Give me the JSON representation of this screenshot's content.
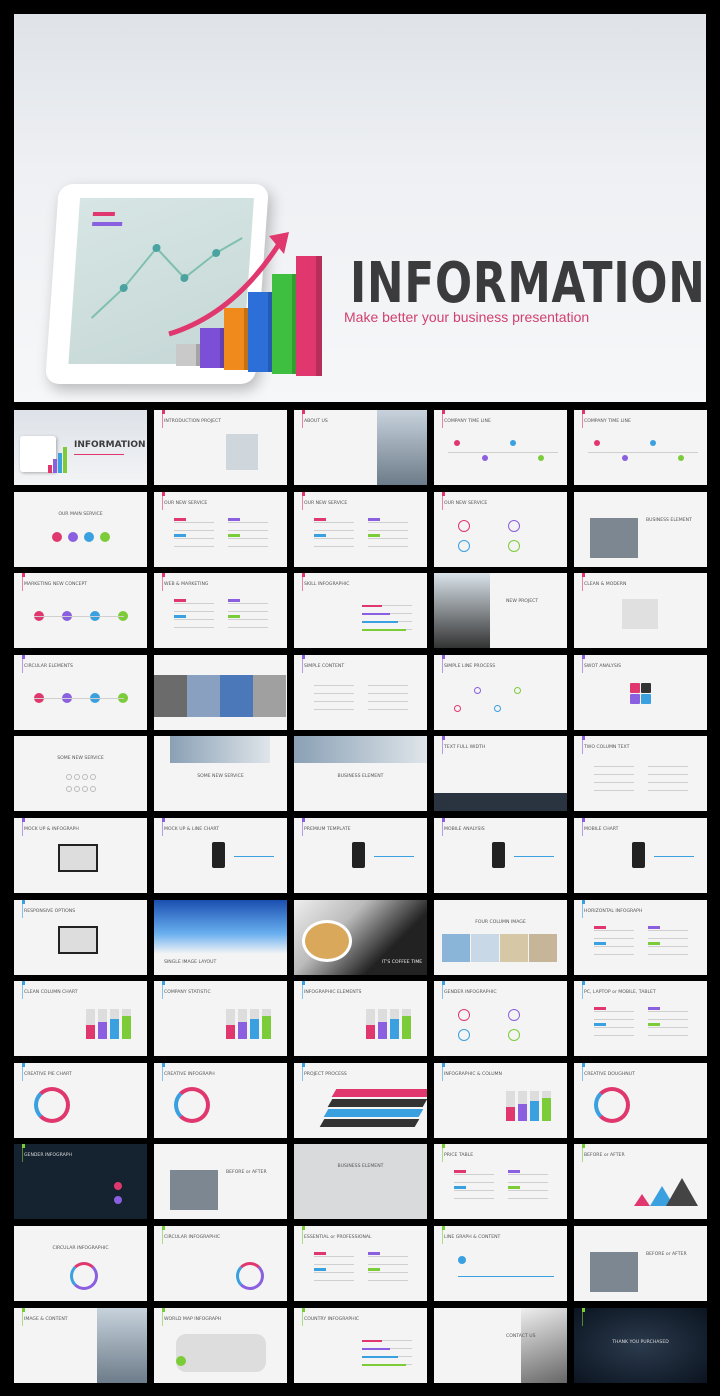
{
  "hero": {
    "title": "INFORMATION",
    "subtitle": "Make better your business presentation",
    "accent": "#d2406e",
    "bar_colors": [
      "#c9c9c9",
      "#7b4fd6",
      "#f08a1c",
      "#2d6fd8",
      "#3fbf3f",
      "#e0386e"
    ]
  },
  "colors": {
    "pink": "#e0386e",
    "purple": "#8a5fe0",
    "blue": "#3aa0e0",
    "green": "#7ccc3a",
    "dark": "#333333"
  },
  "slides": [
    {
      "title": "INFORMATION",
      "type": "cover"
    },
    {
      "title": "INTRODUCTION PROJECT",
      "type": "text",
      "decor": "photo-right-small"
    },
    {
      "title": "ABOUT US",
      "type": "text",
      "decor": "photo-right"
    },
    {
      "title": "COMPANY TIME LINE",
      "type": "text",
      "decor": "timeline"
    },
    {
      "title": "COMPANY TIME LINE",
      "type": "text",
      "decor": "timeline"
    },
    {
      "title": "OUR MAIN SERVICE",
      "type": "center",
      "decor": "circles4"
    },
    {
      "title": "OUR NEW SERVICE",
      "type": "text",
      "decor": "tags"
    },
    {
      "title": "OUR NEW SERVICE",
      "type": "text",
      "decor": "list2"
    },
    {
      "title": "OUR NEW SERVICE",
      "type": "text",
      "decor": "rings"
    },
    {
      "title": "BUSINESS ELEMENT",
      "type": "text-right",
      "decor": "photo-left-small"
    },
    {
      "title": "MARKETING NEW CONCEPT",
      "type": "text",
      "decor": "dotline"
    },
    {
      "title": "WEB & MARKETING",
      "type": "text",
      "decor": "list2"
    },
    {
      "title": "SKILL INFOGRAPHIC",
      "type": "text",
      "decor": "bars-h"
    },
    {
      "title": "NEW PROJECT",
      "type": "text-right",
      "decor": "photo-left"
    },
    {
      "title": "CLEAN & MODERN",
      "type": "text",
      "decor": "photo-center"
    },
    {
      "title": "CIRCULAR ELEMENTS",
      "type": "text",
      "decor": "dotline"
    },
    {
      "title": "",
      "type": "photo",
      "decor": "collage"
    },
    {
      "title": "SIMPLE CONTENT",
      "type": "text",
      "decor": "lines"
    },
    {
      "title": "SIMPLE LINE PROCESS",
      "type": "text",
      "decor": "process"
    },
    {
      "title": "SWOT ANALYSIS",
      "type": "text",
      "decor": "swot"
    },
    {
      "title": "SOME NEW SERVICE",
      "type": "center",
      "decor": "icons"
    },
    {
      "title": "SOME NEW SERVICE",
      "type": "center-low",
      "decor": "photo-top"
    },
    {
      "title": "BUSINESS ELEMENT",
      "type": "center-low",
      "decor": "photo-top"
    },
    {
      "title": "TEXT FULL WIDTH",
      "type": "text",
      "decor": "photo-bottom"
    },
    {
      "title": "TWO COLUMN TEXT",
      "type": "text",
      "decor": "lines"
    },
    {
      "title": "MOCK UP & INFOGRAPH",
      "type": "text",
      "decor": "monitor"
    },
    {
      "title": "MOCK UP & LINE CHART",
      "type": "text",
      "decor": "phone"
    },
    {
      "title": "PREMIUM TEMPLATE",
      "type": "text",
      "decor": "phone"
    },
    {
      "title": "MOBILE ANALYSIS",
      "type": "text",
      "decor": "phone"
    },
    {
      "title": "MOBILE CHART",
      "type": "text",
      "decor": "phone"
    },
    {
      "title": "RESPONSIVE OPTIONS",
      "type": "text",
      "decor": "monitor"
    },
    {
      "title": "SINGLE IMAGE LAYOUT",
      "type": "photo-bottom-title",
      "decor": "sky"
    },
    {
      "title": "IT'S COFFEE TIME",
      "type": "photo-bottom-title",
      "decor": "coffee"
    },
    {
      "title": "FOUR COLUMN IMAGE",
      "type": "center",
      "decor": "four"
    },
    {
      "title": "HORIZONTAL INFOGRAPH",
      "type": "text",
      "decor": "tags"
    },
    {
      "title": "CLEAN COLUMN CHART",
      "type": "text",
      "decor": "columns"
    },
    {
      "title": "COMPANY STATISTIC",
      "type": "text",
      "decor": "columns"
    },
    {
      "title": "INFOGRAPHIC ELEMENTS",
      "type": "text",
      "decor": "columns"
    },
    {
      "title": "GENDER INFOGRAPHIC",
      "type": "text",
      "decor": "rings"
    },
    {
      "title": "PC, LAPTOP or MOBILE, TABLET",
      "type": "text",
      "decor": "tags"
    },
    {
      "title": "CREATIVE PIE CHART",
      "type": "text",
      "decor": "donut"
    },
    {
      "title": "CREATIVE INFOGRAPH",
      "type": "text",
      "decor": "donut"
    },
    {
      "title": "PROJECT PROCESS",
      "type": "text",
      "decor": "stripes"
    },
    {
      "title": "INFOGRAPHIC & COLUMN",
      "type": "text",
      "decor": "columns"
    },
    {
      "title": "CREATIVE DOUGHNUT",
      "type": "text",
      "decor": "donut"
    },
    {
      "title": "GENDER INFOGRAPH",
      "type": "dark",
      "decor": "dark"
    },
    {
      "title": "BEFORE or AFTER",
      "type": "text-right",
      "decor": "photo-left-small"
    },
    {
      "title": "BUSINESS ELEMENT",
      "type": "center",
      "decor": "grey"
    },
    {
      "title": "PRICE TABLE",
      "type": "text",
      "decor": "price"
    },
    {
      "title": "BEFORE or AFTER",
      "type": "text",
      "decor": "triangles"
    },
    {
      "title": "CIRCULAR INFOGRAPHIC",
      "type": "center",
      "decor": "arcs"
    },
    {
      "title": "CIRCULAR INFOGRAPHIC",
      "type": "text",
      "decor": "arcs"
    },
    {
      "title": "ESSENTIAL or PROFESSIONAL",
      "type": "text",
      "decor": "tags"
    },
    {
      "title": "LINE GRAPH & CONTENT",
      "type": "text",
      "decor": "wave"
    },
    {
      "title": "BEFORE or AFTER",
      "type": "text-right",
      "decor": "photo-left-small"
    },
    {
      "title": "IMAGE & CONTENT",
      "type": "text",
      "decor": "photo-right"
    },
    {
      "title": "WORLD MAP INFOGRAPH",
      "type": "text",
      "decor": "map"
    },
    {
      "title": "COUNTRY INFOGRAPHIC",
      "type": "text",
      "decor": "bars-h"
    },
    {
      "title": "CONTACT US",
      "type": "text-right",
      "decor": "building"
    },
    {
      "title": "THANK YOU PURCHASED",
      "type": "dark",
      "decor": "thanks"
    }
  ]
}
